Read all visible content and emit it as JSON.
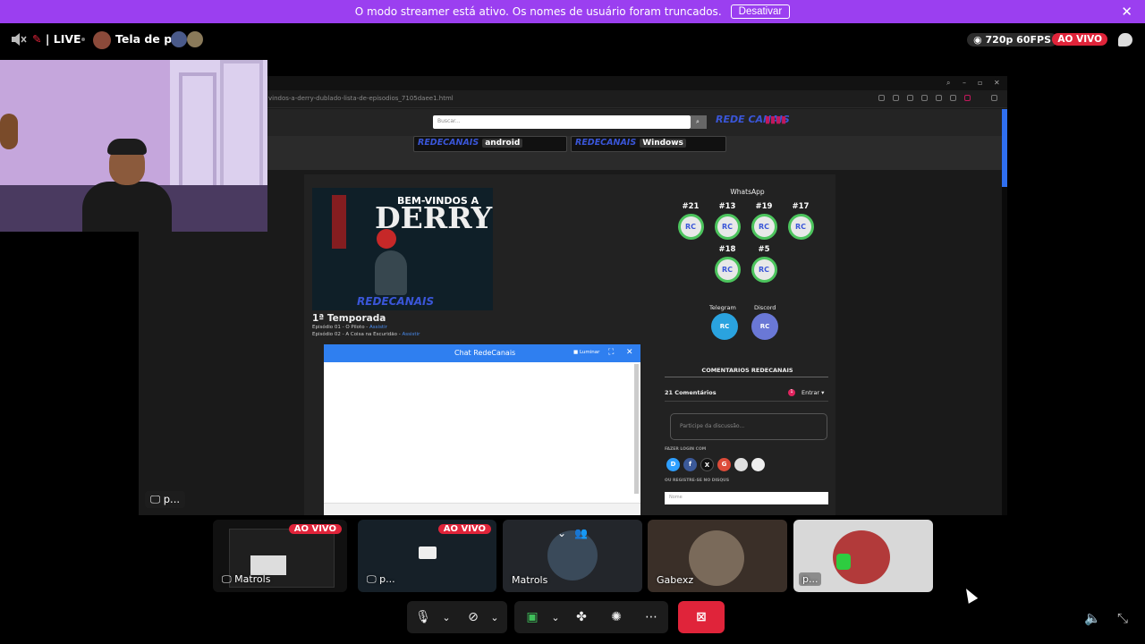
{
  "banner": {
    "text": "O modo streamer está ativo. Os nomes de usuário foram truncados.",
    "button": "Desativar",
    "close_icon": "close-icon"
  },
  "topbar": {
    "live_label": "| LIVE",
    "title": "Tela de p...",
    "quality": "720p 60FPS",
    "live_badge": "AO VIVO"
  },
  "stage": {
    "label": "p...",
    "browser": {
      "url": "vindos-a-derry-dublado-lista-de-episodios_7105daee1.html"
    },
    "site": {
      "search_placeholder": "Buscar...",
      "logo": "REDE CANAIS",
      "banners": [
        {
          "brand": "REDECANAIS",
          "tag": "android"
        },
        {
          "brand": "REDECANAIS",
          "tag": "Windows"
        }
      ],
      "poster": {
        "line1": "BEM-VINDOS A",
        "line2": "DERRY",
        "logo": "REDECANAIS"
      },
      "season_title": "1ª Temporada",
      "episodes": [
        {
          "label": "Episódio 01 - O Piloto - ",
          "link": "Assistir"
        },
        {
          "label": "Episódio 02 - A Coisa na Escuridão - ",
          "link": "Assistir"
        }
      ],
      "chat": {
        "title": "Chat RedeCanais",
        "minimize": "■ Luminar"
      },
      "side": {
        "whatsapp_heading": "WhatsApp",
        "whatsapp_groups": [
          "#21",
          "#13",
          "#19",
          "#17",
          "#18",
          "#5"
        ],
        "whatsapp_icon_text": "RC",
        "telegram_label": "Telegram",
        "discord_label": "Discord",
        "comments_title": "COMENTARIOS REDECANAIS",
        "comments_count": "21 Comentários",
        "comments_login": "Entrar ▾",
        "comments_placeholder": "Participe da discussão...",
        "login_with": "FAZER LOGIN COM",
        "or_register": "OU REGISTRE-SE NO DISQUS",
        "name_placeholder": "Nome",
        "login_icons": [
          "D",
          "f",
          "X",
          "G",
          "",
          ""
        ]
      }
    }
  },
  "tiles": [
    {
      "label": "Matrols",
      "live": "AO VIVO"
    },
    {
      "label": "p...",
      "live": "AO VIVO"
    },
    {
      "label": "Matrols"
    },
    {
      "label": "Gabexz"
    },
    {
      "label": "p..."
    }
  ],
  "colors": {
    "accent": "#9b3ff0",
    "live_red": "#e0243a",
    "browser_blue": "#2f7ff0"
  }
}
